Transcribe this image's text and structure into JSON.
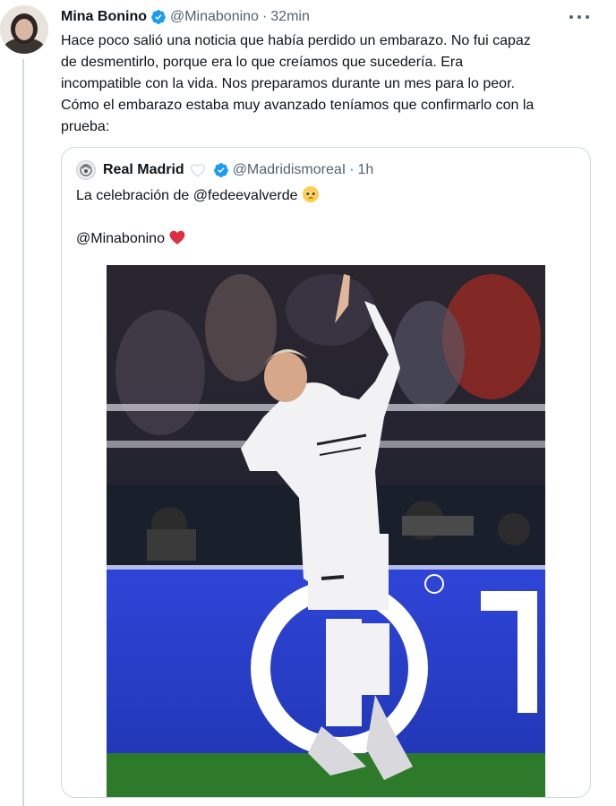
{
  "tweet": {
    "author_name": "Mina Bonino",
    "author_handle": "@Minabonino",
    "separator": "·",
    "time": "32min",
    "text_lines": [
      "Hace poco salió una noticia que había perdido un embarazo. No fui capaz",
      "de desmentirlo, porque era lo que creíamos que sucedería. Era",
      "incompatible con la vida. Nos preparamos durante un mes para lo peor.",
      "Cómo el embarazo estaba muy avanzado teníamos que confirmarlo con la",
      "prueba:"
    ]
  },
  "quoted": {
    "author_name": "Real Madrid",
    "author_handle": "@MadridismoreaI",
    "separator": "·",
    "time": "1h",
    "line1": "La celebración de @fedeevalverde",
    "line2": "@Minabonino"
  },
  "colors": {
    "text": "#0f1419",
    "secondary": "#536471",
    "verified": "#1d9bf0",
    "border": "#cfd9de",
    "heart": "#f4245e"
  },
  "icons": [
    "verified-badge-icon",
    "more-options-icon",
    "white-heart-icon",
    "pleading-face-icon",
    "red-heart-icon"
  ]
}
